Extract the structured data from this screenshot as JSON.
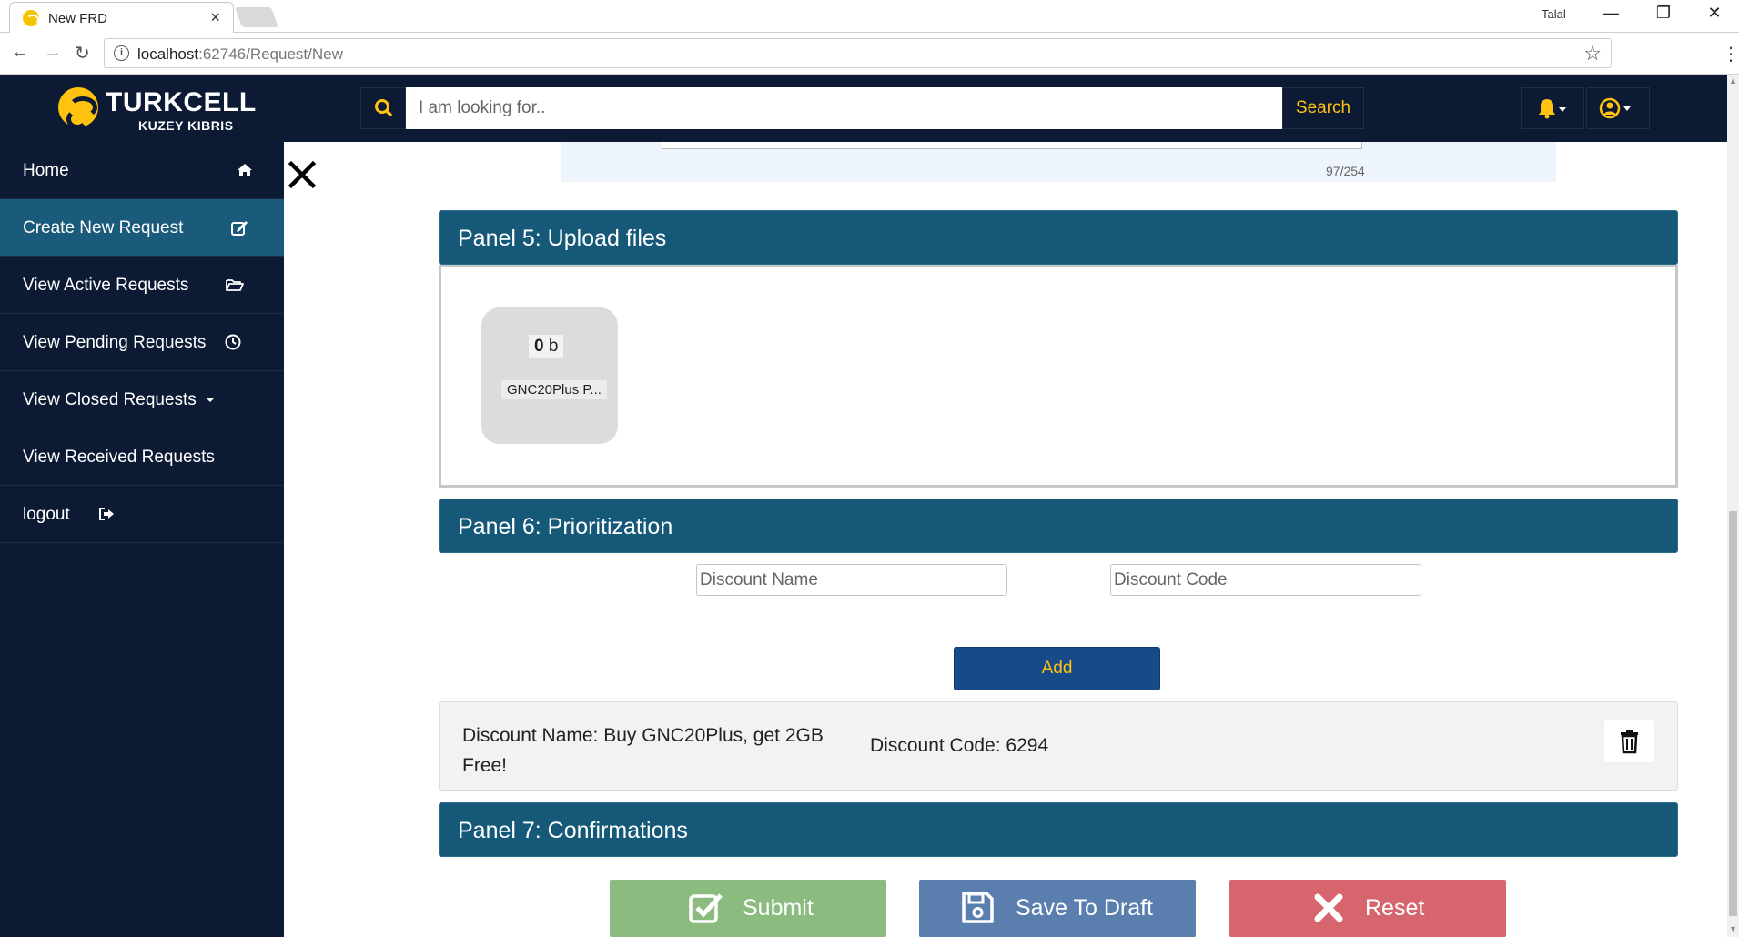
{
  "browser": {
    "tab_title": "New FRD",
    "tab_close": "×",
    "profile_name": "Talal",
    "url_host": "localhost",
    "url_rest": ":62746/Request/New",
    "win_minimize": "—",
    "win_restore": "❐",
    "win_close": "✕"
  },
  "header": {
    "logo_title": "TURKCELL",
    "logo_subtitle": "KUZEY KIBRIS",
    "search_placeholder": "I am looking for..",
    "search_button": "Search"
  },
  "sidebar": {
    "items": [
      {
        "label": "Home",
        "icon": "home-icon"
      },
      {
        "label": "Create New Request",
        "icon": "edit-icon",
        "active": true
      },
      {
        "label": "View Active Requests",
        "icon": "folder-open-icon"
      },
      {
        "label": "View Pending Requests",
        "icon": "clock-icon"
      },
      {
        "label": "View Closed Requests",
        "icon": "caret-down-icon"
      },
      {
        "label": "View Received Requests",
        "icon": ""
      },
      {
        "label": "logout",
        "icon": "sign-out-icon"
      }
    ]
  },
  "main": {
    "char_count": "97/254",
    "panel5": {
      "title": "Panel 5: Upload files",
      "file": {
        "size_value": "0",
        "size_unit": "b",
        "name": "GNC20Plus P..."
      }
    },
    "panel6": {
      "title": "Panel 6: Prioritization",
      "discount_name_placeholder": "Discount Name",
      "discount_code_placeholder": "Discount Code",
      "add_button": "Add",
      "entry": {
        "name": "Discount Name: Buy GNC20Plus, get 2GB Free!",
        "code": "Discount Code: 6294"
      }
    },
    "panel7": {
      "title": "Panel 7: Confirmations"
    },
    "actions": {
      "submit": "Submit",
      "save_draft": "Save To Draft",
      "reset": "Reset"
    }
  },
  "colors": {
    "header_bg": "#0c1a33",
    "accent_yellow": "#ffc20e",
    "panel_bg": "#165878",
    "sidebar_active": "#1a5a7a",
    "submit_green": "#8bbb7e",
    "draft_blue": "#5a7fae",
    "reset_red": "#d6656d"
  }
}
